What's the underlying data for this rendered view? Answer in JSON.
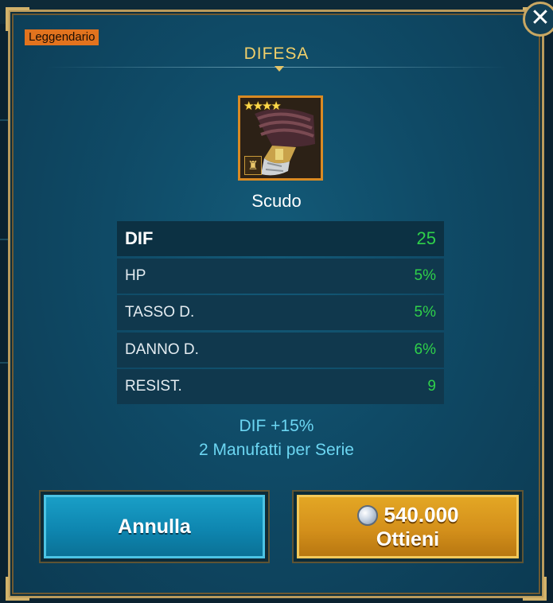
{
  "rarity": "Leggendario",
  "title": "DIFESA",
  "item": {
    "name": "Scudo",
    "stars_count": 4,
    "stars_text": "★★★★",
    "set_icon": "castle-set-icon"
  },
  "stats": [
    {
      "label": "DIF",
      "value": "25"
    },
    {
      "label": "HP",
      "value": "5%"
    },
    {
      "label": "TASSO D.",
      "value": "5%"
    },
    {
      "label": "DANNO D.",
      "value": "6%"
    },
    {
      "label": "RESIST.",
      "value": "9"
    }
  ],
  "set_bonus": {
    "effect": "DIF +15%",
    "requirement": "2 Manufatti per Serie"
  },
  "buttons": {
    "cancel": "Annulla",
    "buy_price": "540.000",
    "buy_label": "Ottieni"
  },
  "icons": {
    "close": "close-icon",
    "currency": "silver-coin-icon"
  },
  "colors": {
    "rarity": "#e2731e",
    "title": "#f1cf6a",
    "stat_value": "#2fd04a",
    "bonus_text": "#6cd6f2",
    "cancel_button": "#0e86b0",
    "buy_button": "#d4901b"
  }
}
